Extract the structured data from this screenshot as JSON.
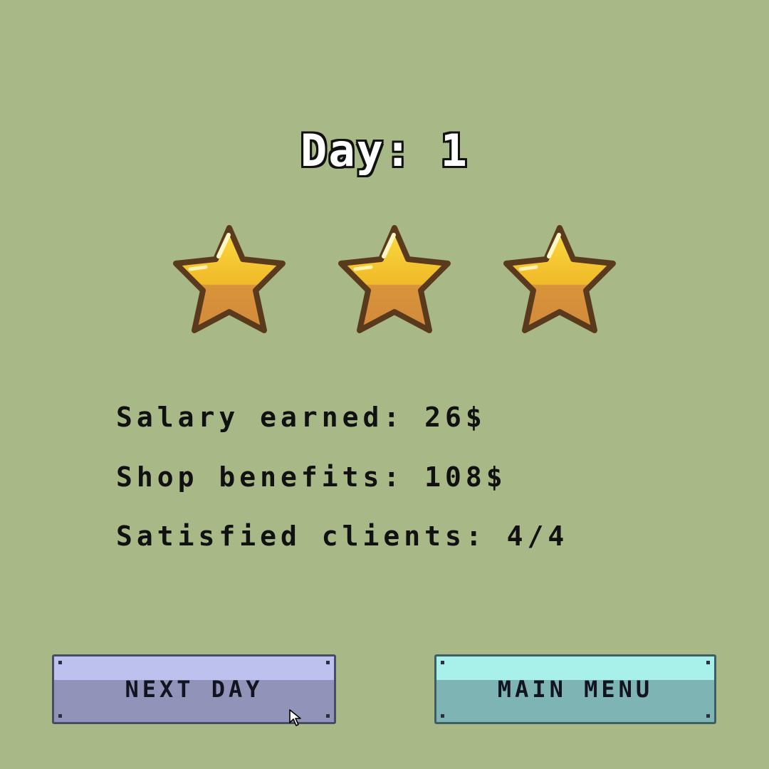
{
  "header": {
    "title": "Day: 1"
  },
  "rating": {
    "stars_earned": 3,
    "stars_total": 3,
    "star_color": "#f2c12e",
    "star_outline": "#5a3a1c"
  },
  "stats": {
    "salary": "Salary earned: 26$",
    "shop": "Shop benefits: 108$",
    "clients": "Satisfied clients: 4/4"
  },
  "buttons": {
    "next_day": "NEXT DAY",
    "main_menu": "MAIN MENU"
  },
  "colors": {
    "background": "#a8b886",
    "next_day_button": "#9193b8",
    "main_menu_button": "#7eb4b4"
  }
}
